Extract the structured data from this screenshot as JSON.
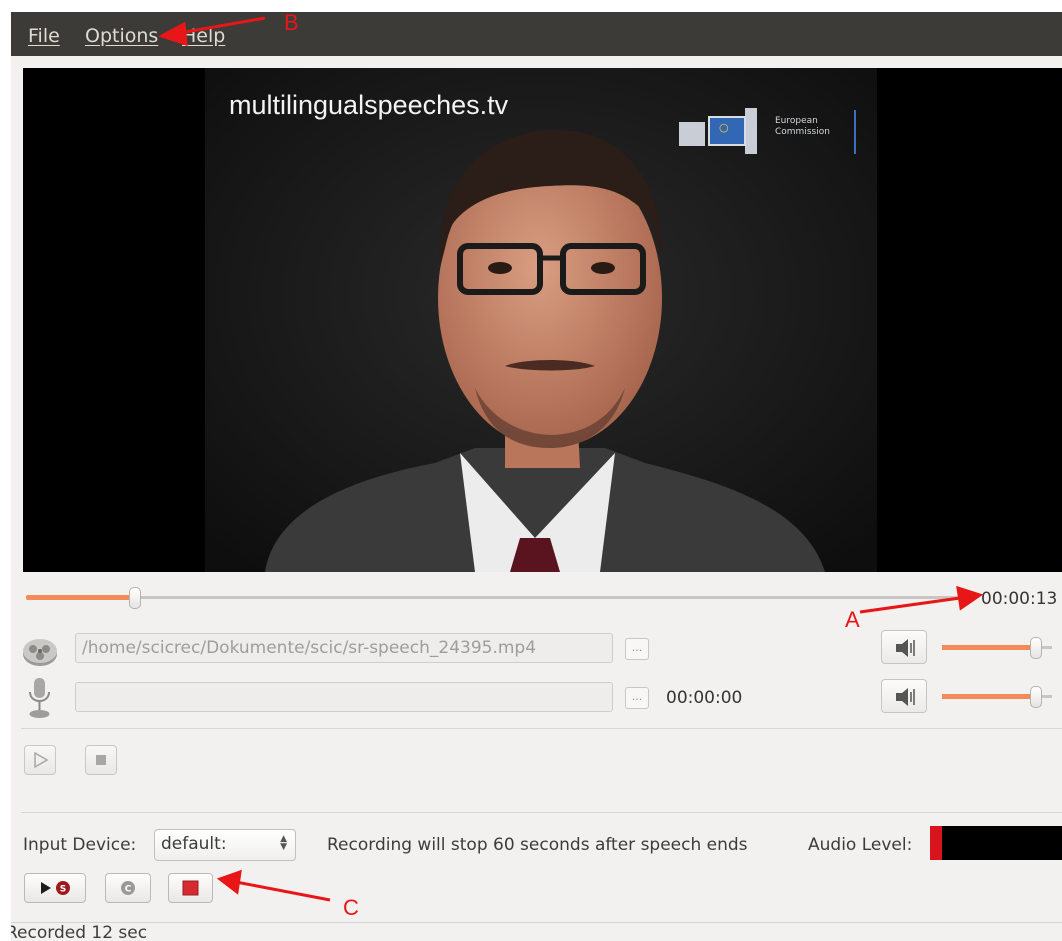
{
  "menu": {
    "file": "File",
    "options": "Options",
    "help": "Help"
  },
  "video": {
    "watermark": "multilingualspeeches.tv",
    "logo_line1": "European",
    "logo_line2": "Commission"
  },
  "seek": {
    "progress": 0.115,
    "time": "00:00:13"
  },
  "source": {
    "path": "/home/scicrec/Dokumente/scic/sr-speech_24395.mp4",
    "browse_label": "...",
    "volume": 0.85,
    "icon": "film-reel-icon"
  },
  "recording": {
    "path": "",
    "browse_label": "...",
    "time": "00:00:00",
    "volume": 0.85,
    "icon": "microphone-icon"
  },
  "input": {
    "device_label": "Input Device:",
    "device_value": "default:",
    "note": "Recording will stop 60 seconds after speech ends",
    "audio_level_label": "Audio Level:"
  },
  "status": {
    "text": "Recorded 12 sec"
  },
  "annotations": {
    "a": "A",
    "b": "B",
    "c": "C"
  },
  "colors": {
    "accent": "#f28b58",
    "record_red": "#d8141c",
    "menubar": "#3c3b37",
    "annotation": "#e81717"
  }
}
